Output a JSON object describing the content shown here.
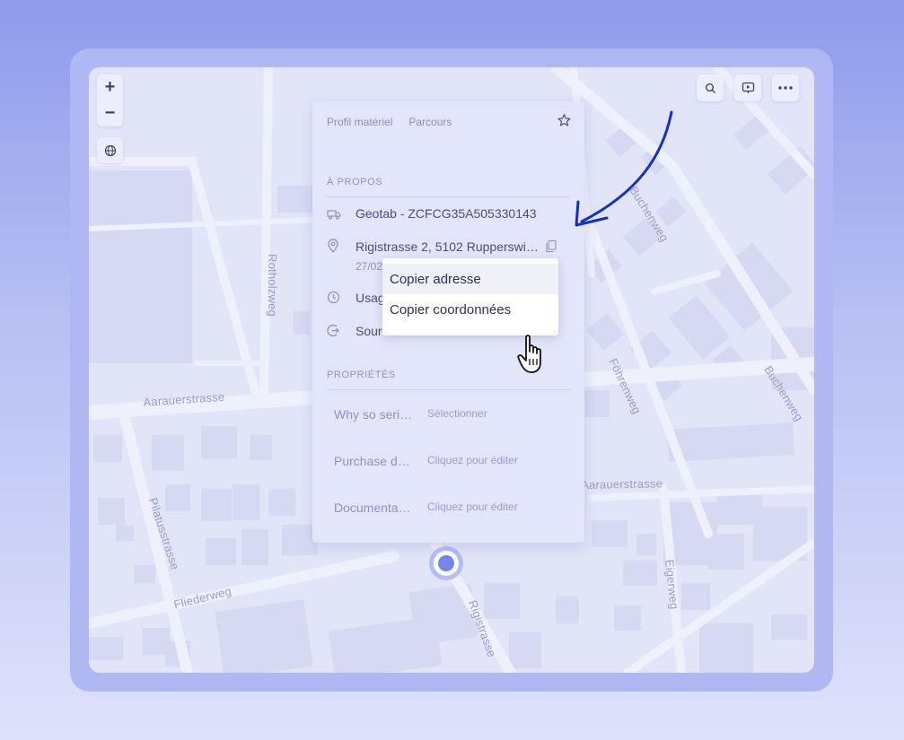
{
  "map": {
    "streets": {
      "aarauerstrasse_west": "Aarauerstrasse",
      "aarauerstrasse_east": "Aarauerstrasse",
      "rotholzweg": "Rotholzweg",
      "buchenweg_north": "Buchenweg",
      "buchenweg_south": "Buchenweg",
      "fohrenweg": "Föhrenweg",
      "pilatusstrasse": "Pilatusstrasse",
      "fliederweg": "Fliederweg",
      "rigistrasse": "Rigistrasse",
      "eigerweg": "Eigerweg"
    },
    "controls": {
      "zoom_in": "+",
      "zoom_out": "−"
    }
  },
  "popup": {
    "tabs": [
      "Profil matériel",
      "Parcours"
    ],
    "about_title": "À PROPOS",
    "device": "Geotab - ZCFCG35A505330143",
    "address": "Rigistrasse 2, 5102 Rupperswi…",
    "address_sub": "27/02",
    "usage": "Usag",
    "source": "Sour",
    "properties_title": "PROPRIÉTÉS",
    "properties": [
      {
        "name": "Why so seri…",
        "value": "Sélectionner"
      },
      {
        "name": "Purchase d…",
        "value": "Cliquez pour éditer"
      },
      {
        "name": "Documenta…",
        "value": "Cliquez pour éditer"
      }
    ]
  },
  "dropdown": {
    "items": [
      "Copier adresse",
      "Copier coordonnées"
    ]
  },
  "colors": {
    "accent": "#1230c9",
    "marker": "#7386ea",
    "map_bg": "#e2e4f8"
  }
}
